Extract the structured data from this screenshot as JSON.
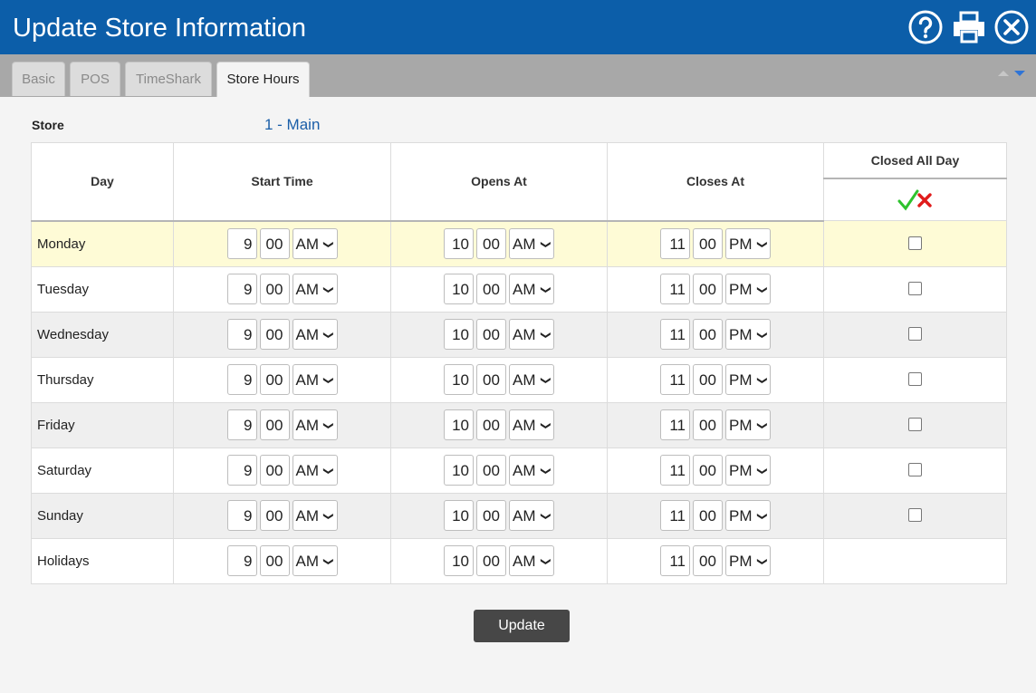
{
  "window": {
    "title": "Update Store Information",
    "help_icon": "help-circle-icon",
    "print_icon": "printer-icon",
    "close_icon": "close-circle-icon"
  },
  "tabs": [
    {
      "label": "Basic"
    },
    {
      "label": "POS"
    },
    {
      "label": "TimeShark"
    },
    {
      "label": "Store Hours",
      "active": true
    }
  ],
  "store": {
    "label": "Store",
    "value": "1 - Main"
  },
  "table": {
    "headers": {
      "day": "Day",
      "start": "Start Time",
      "opens": "Opens At",
      "closes": "Closes At",
      "closed": "Closed All Day",
      "check_all_icon": "check-all-icon",
      "clear_all_icon": "clear-all-icon"
    },
    "rows": [
      {
        "day": "Monday",
        "start": [
          "9",
          "00",
          "AM"
        ],
        "opens": [
          "10",
          "00",
          "AM"
        ],
        "closes": [
          "11",
          "00",
          "PM"
        ],
        "closed": false
      },
      {
        "day": "Tuesday",
        "start": [
          "9",
          "00",
          "AM"
        ],
        "opens": [
          "10",
          "00",
          "AM"
        ],
        "closes": [
          "11",
          "00",
          "PM"
        ],
        "closed": false
      },
      {
        "day": "Wednesday",
        "start": [
          "9",
          "00",
          "AM"
        ],
        "opens": [
          "10",
          "00",
          "AM"
        ],
        "closes": [
          "11",
          "00",
          "PM"
        ],
        "closed": false
      },
      {
        "day": "Thursday",
        "start": [
          "9",
          "00",
          "AM"
        ],
        "opens": [
          "10",
          "00",
          "AM"
        ],
        "closes": [
          "11",
          "00",
          "PM"
        ],
        "closed": false
      },
      {
        "day": "Friday",
        "start": [
          "9",
          "00",
          "AM"
        ],
        "opens": [
          "10",
          "00",
          "AM"
        ],
        "closes": [
          "11",
          "00",
          "PM"
        ],
        "closed": false
      },
      {
        "day": "Saturday",
        "start": [
          "9",
          "00",
          "AM"
        ],
        "opens": [
          "10",
          "00",
          "AM"
        ],
        "closes": [
          "11",
          "00",
          "PM"
        ],
        "closed": false
      },
      {
        "day": "Sunday",
        "start": [
          "9",
          "00",
          "AM"
        ],
        "opens": [
          "10",
          "00",
          "AM"
        ],
        "closes": [
          "11",
          "00",
          "PM"
        ],
        "closed": false
      },
      {
        "day": "Holidays",
        "start": [
          "9",
          "00",
          "AM"
        ],
        "opens": [
          "10",
          "00",
          "AM"
        ],
        "closes": [
          "11",
          "00",
          "PM"
        ],
        "closed": null
      }
    ]
  },
  "update_button": "Update",
  "colors": {
    "titlebar": "#0c5ea9",
    "tabbar": "#a8a8a8",
    "highlight_row": "#fefbd6",
    "store_link": "#1a5ea8",
    "button": "#474747",
    "check_green": "#2ec22e",
    "cross_red": "#e01b1b"
  }
}
